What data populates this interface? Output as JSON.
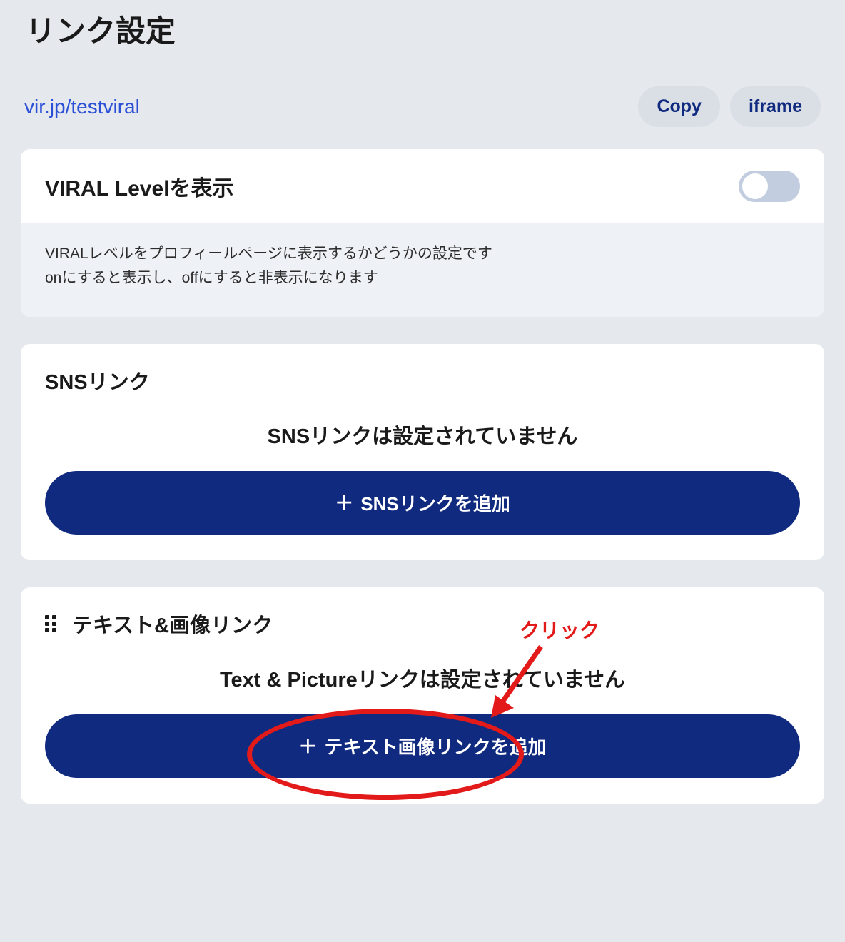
{
  "page": {
    "title": "リンク設定"
  },
  "url": {
    "text": "vir.jp/testviral",
    "copy_label": "Copy",
    "iframe_label": "iframe"
  },
  "viral_level": {
    "title": "VIRAL Levelを表示",
    "desc_line1": "VIRALレベルをプロフィールページに表示するかどうかの設定です",
    "desc_line2": "onにすると表示し、offにすると非表示になります",
    "enabled": false
  },
  "sns": {
    "title": "SNSリンク",
    "empty": "SNSリンクは設定されていません",
    "add_label": "SNSリンクを追加"
  },
  "text_image": {
    "title": "テキスト&画像リンク",
    "empty": "Text & Pictureリンクは設定されていません",
    "add_label": "テキスト画像リンクを追加"
  },
  "annotation": {
    "click_label": "クリック"
  }
}
